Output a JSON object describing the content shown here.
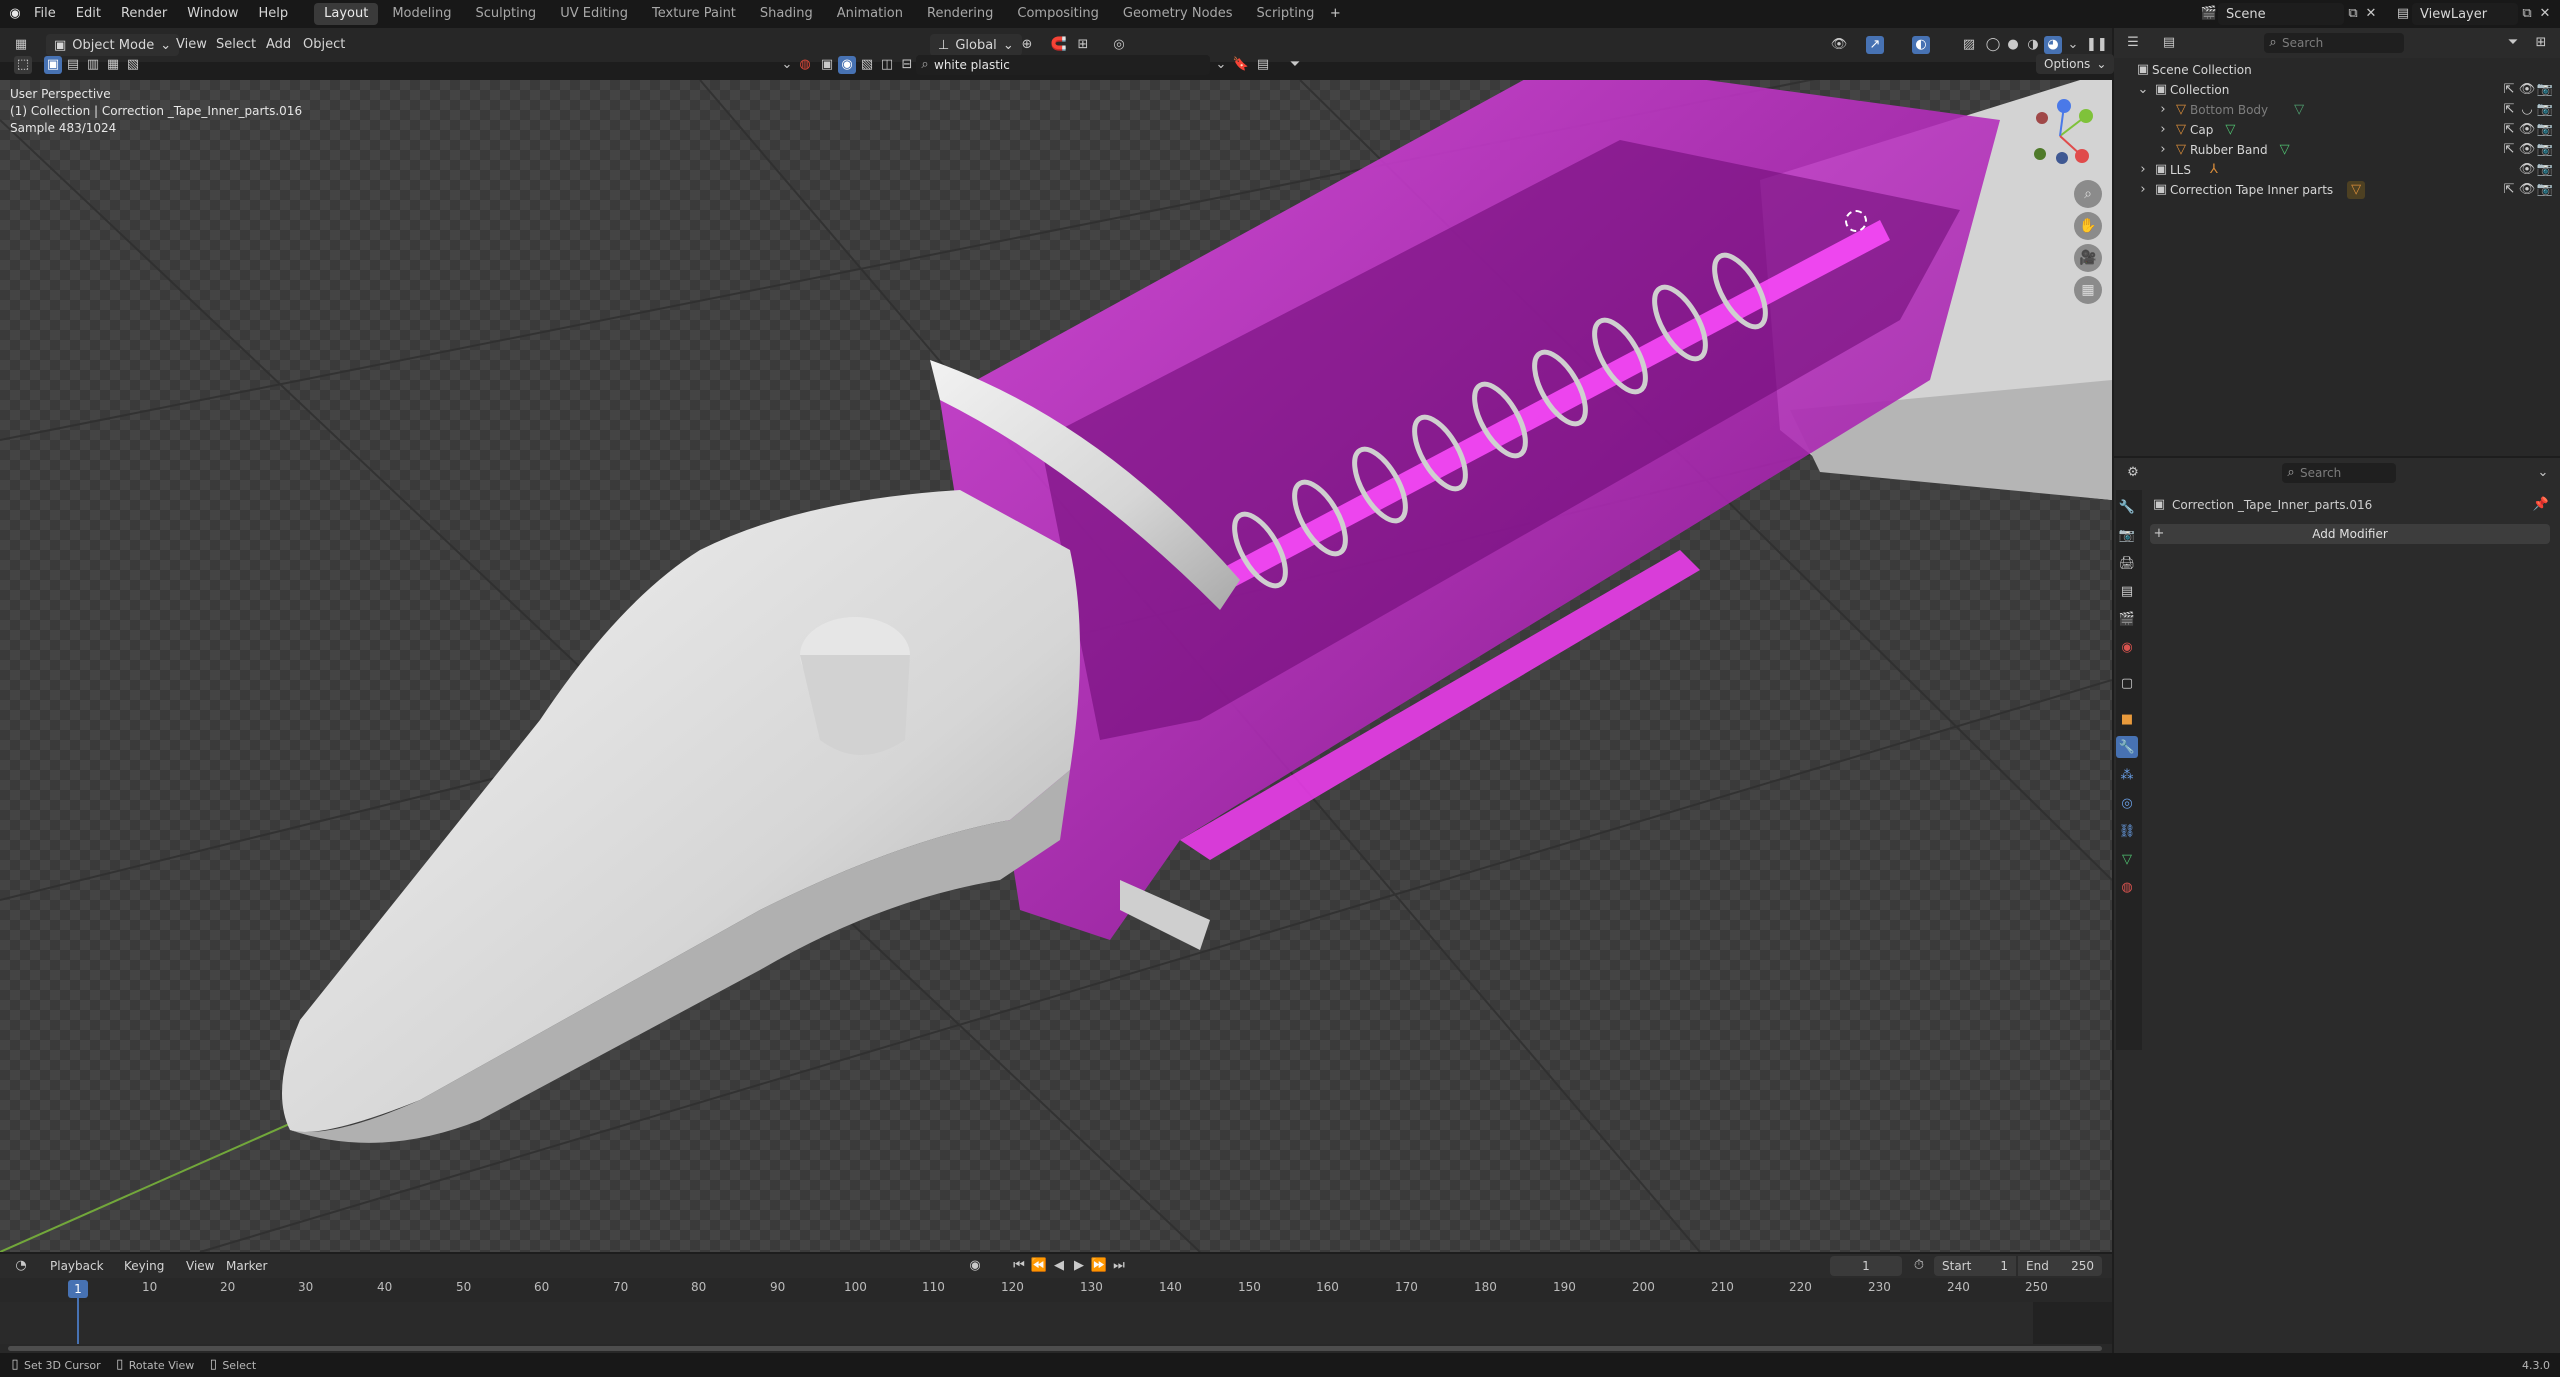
{
  "topbar": {
    "menus": [
      "File",
      "Edit",
      "Render",
      "Window",
      "Help"
    ],
    "workspaces": [
      "Layout",
      "Modeling",
      "Sculpting",
      "UV Editing",
      "Texture Paint",
      "Shading",
      "Animation",
      "Rendering",
      "Compositing",
      "Geometry Nodes",
      "Scripting"
    ],
    "active_workspace": "Layout",
    "scene": "Scene",
    "view_layer": "ViewLayer"
  },
  "viewport_header": {
    "mode": "Object Mode",
    "menus": [
      "View",
      "Select",
      "Add",
      "Object"
    ],
    "transform_orientation": "Global",
    "options_label": "Options",
    "material_search_value": "white plastic"
  },
  "viewport_overlay": {
    "line1": "User Perspective",
    "line2": "(1) Collection | Correction _Tape_Inner_parts.016",
    "line3": "Sample 483/1024"
  },
  "outliner": {
    "search_placeholder": "Search",
    "root": "Scene Collection",
    "rows": [
      {
        "label": "Collection",
        "indent": 1
      },
      {
        "label": "Bottom Body",
        "indent": 2,
        "dim": true
      },
      {
        "label": "Cap",
        "indent": 2
      },
      {
        "label": "Rubber Band",
        "indent": 2
      },
      {
        "label": "LLS",
        "indent": 1
      },
      {
        "label": "Correction Tape Inner parts",
        "indent": 1
      }
    ]
  },
  "properties": {
    "search_placeholder": "Search",
    "object_name": "Correction _Tape_Inner_parts.016",
    "add_modifier_label": "Add Modifier"
  },
  "timeline": {
    "menus": [
      "Playback",
      "Keying",
      "View",
      "Marker"
    ],
    "current_frame": "1",
    "start_label": "Start",
    "start_value": "1",
    "end_label": "End",
    "end_value": "250",
    "playhead": "1",
    "ticks": [
      "10",
      "20",
      "30",
      "40",
      "50",
      "60",
      "70",
      "80",
      "90",
      "100",
      "110",
      "120",
      "130",
      "140",
      "150",
      "160",
      "170",
      "180",
      "190",
      "200",
      "210",
      "220",
      "230",
      "240",
      "250"
    ]
  },
  "statusbar": {
    "items": [
      "Set 3D Cursor",
      "Rotate View",
      "Select"
    ],
    "version": "4.3.0"
  },
  "colors": {
    "accent_blue": "#4772b3",
    "magenta": "#c21ac8",
    "plastic": "#d9d9d9",
    "axis_x": "#e04b4b",
    "axis_y": "#7fc23a",
    "axis_z": "#4a79e8"
  }
}
